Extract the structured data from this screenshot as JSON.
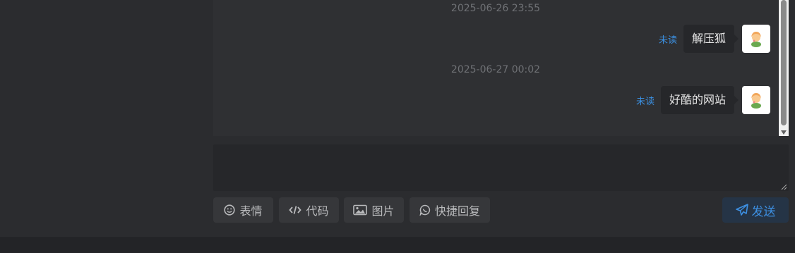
{
  "chat": {
    "messages": [
      {
        "timestamp": "2025-06-26 23:55",
        "status": "未读",
        "text": "解压狐"
      },
      {
        "timestamp": "2025-06-27 00:02",
        "status": "未读",
        "text": "好酷的网站"
      }
    ]
  },
  "composer": {
    "placeholder": "",
    "value": ""
  },
  "toolbar": {
    "emoji_label": "表情",
    "emoji_icon": "smile-icon",
    "code_label": "代码",
    "code_icon": "code-icon",
    "image_label": "图片",
    "image_icon": "image-icon",
    "quick_reply_label": "快捷回复",
    "quick_reply_icon": "chat-bubble-icon",
    "send_label": "发送",
    "send_icon": "paper-plane-icon"
  },
  "colors": {
    "accent": "#3b8fe0",
    "background": "#2b2c2f",
    "panel": "#2f3033"
  }
}
